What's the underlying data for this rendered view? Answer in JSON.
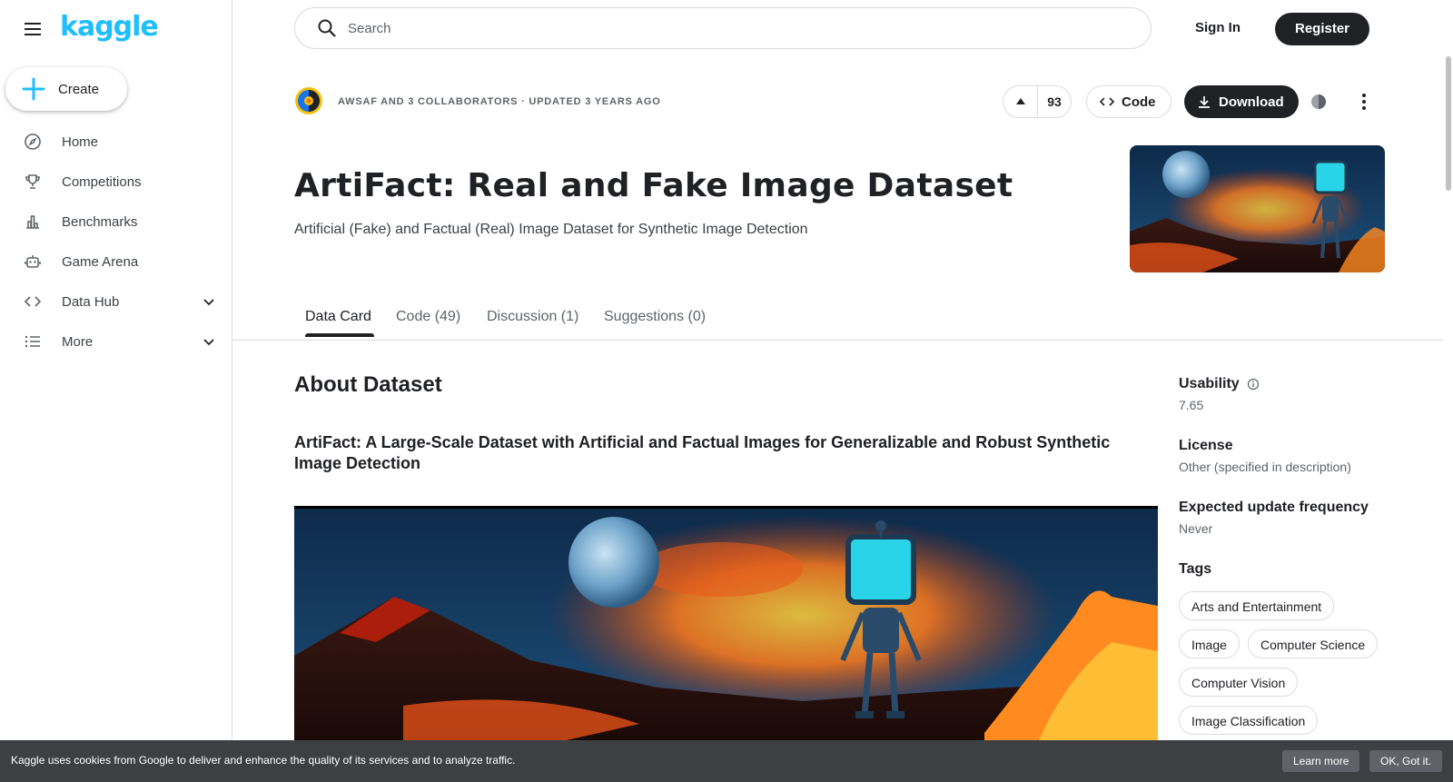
{
  "app": {
    "logo": "kaggle"
  },
  "sidebar": {
    "create_label": "Create",
    "items": [
      {
        "label": "Home",
        "icon": "compass-icon"
      },
      {
        "label": "Competitions",
        "icon": "trophy-icon"
      },
      {
        "label": "Benchmarks",
        "icon": "bar-chart-icon"
      },
      {
        "label": "Game Arena",
        "icon": "robot-icon"
      },
      {
        "label": "Data Hub",
        "icon": "code-icon"
      },
      {
        "label": "More",
        "icon": "list-icon"
      }
    ]
  },
  "topbar": {
    "search_placeholder": "Search",
    "signin_label": "Sign In",
    "register_label": "Register"
  },
  "dataset": {
    "meta": "AWSAF AND 3 COLLABORATORS · UPDATED 3 YEARS AGO",
    "votes": "93",
    "code_label": "Code",
    "download_label": "Download",
    "title": "ArtiFact: Real and Fake Image Dataset",
    "subtitle": "Artificial (Fake) and Factual (Real) Image Dataset for Synthetic Image Detection"
  },
  "tabs": [
    {
      "label": "Data Card",
      "active": true
    },
    {
      "label": "Code (49)"
    },
    {
      "label": "Discussion (1)"
    },
    {
      "label": "Suggestions (0)"
    }
  ],
  "about": {
    "heading": "About Dataset",
    "paper_title": "ArtiFact: A Large-Scale Dataset with Artificial and Factual Images for Generalizable and Robust Synthetic Image Detection"
  },
  "info": {
    "usability_label": "Usability",
    "usability_value": "7.65",
    "license_label": "License",
    "license_value": "Other (specified in description)",
    "frequency_label": "Expected update frequency",
    "frequency_value": "Never",
    "tags_label": "Tags",
    "tags": [
      "Arts and Entertainment",
      "Image",
      "Computer Science",
      "Computer Vision",
      "Image Classification"
    ]
  },
  "cookie": {
    "text": "Kaggle uses cookies from Google to deliver and enhance the quality of its services and to analyze traffic.",
    "learn_more": "Learn more",
    "ok": "OK, Got it."
  },
  "colors": {
    "accent": "#20beff",
    "dark": "#202124",
    "muted": "#5f6368",
    "border": "#dadce0"
  }
}
